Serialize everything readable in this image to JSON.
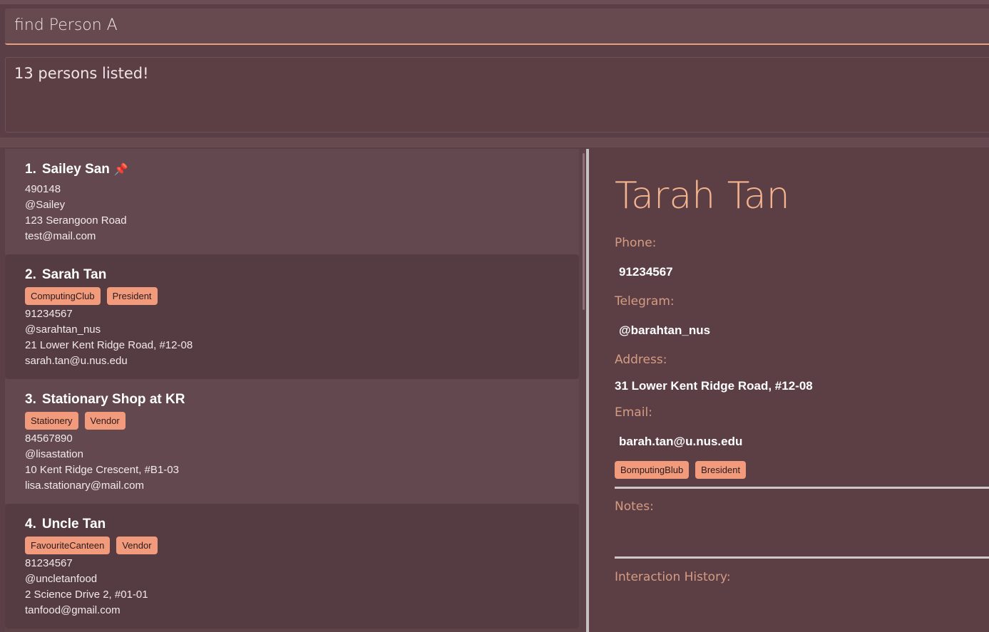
{
  "command": {
    "value": "find Person A"
  },
  "result": {
    "text": "13 persons listed!"
  },
  "persons": [
    {
      "index": "1.",
      "name": "Sailey San",
      "pinned_icon": "pin-icon",
      "tags": [],
      "phone": "490148",
      "telegram": "@Sailey",
      "address": "123 Serangoon Road",
      "email": "test@mail.com"
    },
    {
      "index": "2.",
      "name": "Sarah Tan",
      "tags": [
        "ComputingClub",
        "President"
      ],
      "phone": "91234567",
      "telegram": "@sarahtan_nus",
      "address": "21 Lower Kent Ridge Road, #12-08",
      "email": "sarah.tan@u.nus.edu"
    },
    {
      "index": "3.",
      "name": "Stationary Shop at KR",
      "tags": [
        "Stationery",
        "Vendor"
      ],
      "phone": "84567890",
      "telegram": "@lisastation",
      "address": "10 Kent Ridge Crescent, #B1-03",
      "email": "lisa.stationary@mail.com"
    },
    {
      "index": "4.",
      "name": "Uncle Tan",
      "tags": [
        "FavouriteCanteen",
        "Vendor"
      ],
      "phone": "81234567",
      "telegram": "@uncletanfood",
      "address": "2 Science Drive 2, #01-01",
      "email": "tanfood@gmail.com"
    }
  ],
  "detail": {
    "name": "Tarah Tan",
    "phone_label": "Phone:",
    "phone": "91234567",
    "telegram_label": "Telegram:",
    "telegram": "@barahtan_nus",
    "address_label": "Address:",
    "address": "31 Lower Kent Ridge Road, #12-08",
    "email_label": "Email:",
    "email": "barah.tan@u.nus.edu",
    "tags": [
      "BomputingBlub",
      "Bresident"
    ],
    "notes_label": "Notes:",
    "history_label": "Interaction History:"
  },
  "colors": {
    "background": "#5a4046",
    "accent": "#f4b48e",
    "tag": "#f29a7c"
  }
}
